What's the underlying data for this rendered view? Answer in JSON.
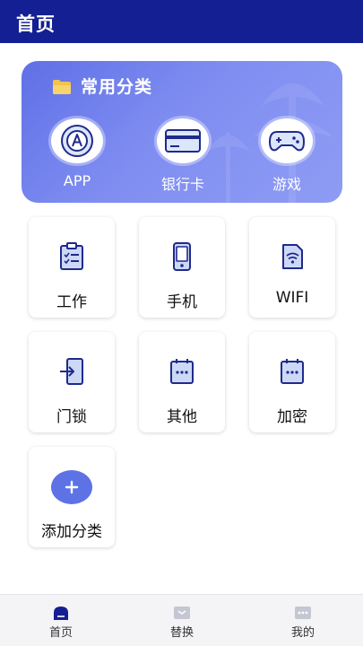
{
  "header": {
    "title": "首页"
  },
  "hero": {
    "title": "常用分类",
    "items": [
      {
        "label": "APP",
        "icon": "app-icon"
      },
      {
        "label": "银行卡",
        "icon": "bank-card-icon"
      },
      {
        "label": "游戏",
        "icon": "gamepad-icon"
      }
    ]
  },
  "categories": [
    {
      "label": "工作",
      "icon": "clipboard-icon"
    },
    {
      "label": "手机",
      "icon": "phone-icon"
    },
    {
      "label": "WIFI",
      "icon": "wifi-icon"
    },
    {
      "label": "门锁",
      "icon": "door-lock-icon"
    },
    {
      "label": "其他",
      "icon": "other-icon"
    },
    {
      "label": "加密",
      "icon": "encrypt-icon"
    }
  ],
  "add_category": {
    "label": "添加分类",
    "icon": "plus-icon"
  },
  "tabs": [
    {
      "label": "首页",
      "icon": "home-icon"
    },
    {
      "label": "替换",
      "icon": "swap-icon"
    },
    {
      "label": "我的",
      "icon": "profile-icon"
    }
  ],
  "colors": {
    "header": "#141f94",
    "accent": "#5d72e4",
    "icon_stroke": "#1f2a8c",
    "icon_fill": "#cdd8f7"
  }
}
